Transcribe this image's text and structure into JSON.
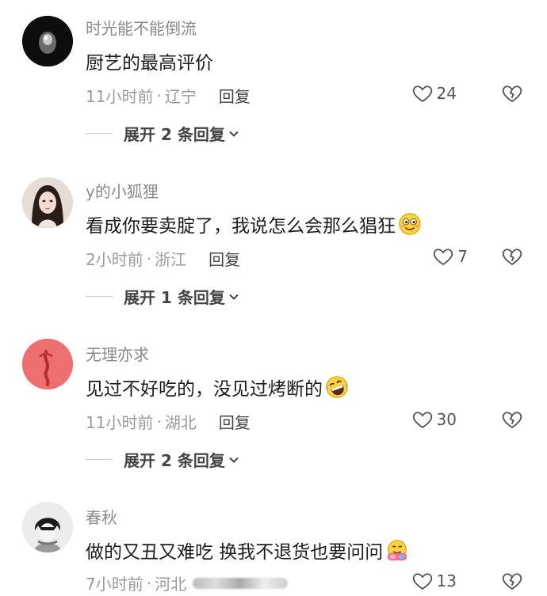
{
  "comments": [
    {
      "username": "时光能不能倒流",
      "text": "厨艺的最高评价",
      "time": "11小时前",
      "location": "辽宁",
      "reply_label": "回复",
      "likes": "24",
      "expand_label": "展开 2 条回复",
      "avatar_icon": "dark-figure-avatar"
    },
    {
      "username": "y的小狐狸",
      "text": "看成你要卖腚了，我说怎么会那么猖狂",
      "time": "2小时前",
      "location": "浙江",
      "reply_label": "回复",
      "likes": "7",
      "expand_label": "展开 1 条回复",
      "avatar_icon": "portrait-avatar"
    },
    {
      "username": "无理亦求",
      "text": "见过不好吃的，没见过烤断的",
      "time": "11小时前",
      "location": "湖北",
      "reply_label": "回复",
      "likes": "30",
      "expand_label": "展开 2 条回复",
      "avatar_icon": "red-abstract-avatar"
    },
    {
      "username": "春秋",
      "text": "做的又丑又难吃 换我不退货也要问问",
      "time": "7小时前",
      "location": "河北",
      "reply_label": "",
      "likes": "13",
      "expand_label": "",
      "avatar_icon": "anime-boy-avatar"
    }
  ],
  "separator": "·",
  "colors": {
    "text": "#1c1c1c",
    "muted": "#8a8a8a",
    "icon": "#555555"
  }
}
